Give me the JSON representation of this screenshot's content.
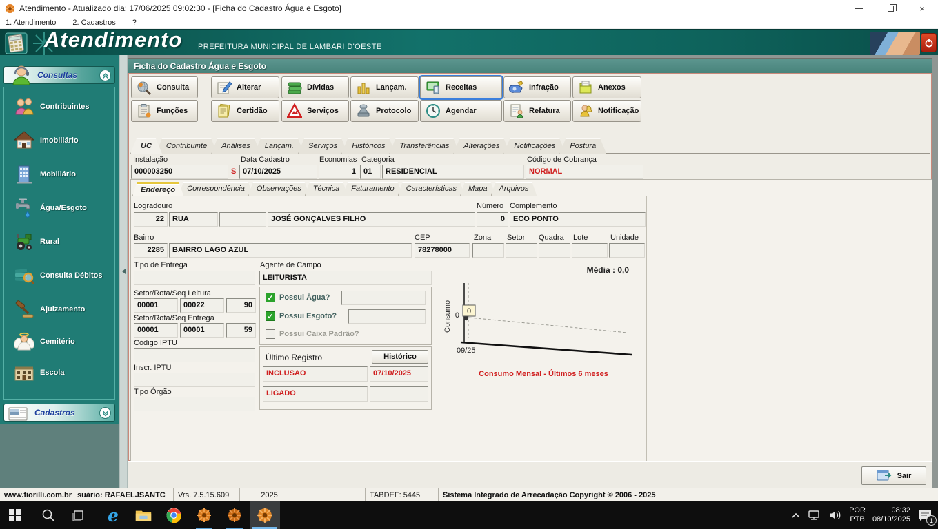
{
  "window": {
    "title": "Atendimento - Atualizado dia: 17/06/2025 09:02:30 - [Ficha do Cadastro Água e Esgoto]",
    "menu": [
      "1. Atendimento",
      "2. Cadastros",
      "?"
    ]
  },
  "banner": {
    "app_name": "Atendimento",
    "subtitle": "PREFEITURA MUNICIPAL DE LAMBARI D'OESTE"
  },
  "sidebar": {
    "consultas_label": "Consultas",
    "items": [
      {
        "label": "Contribuintes"
      },
      {
        "label": "Imobiliário"
      },
      {
        "label": "Mobiliário"
      },
      {
        "label": "Água/Esgoto"
      },
      {
        "label": "Rural"
      },
      {
        "label": "Consulta Débitos"
      },
      {
        "label": "Ajuizamento"
      },
      {
        "label": "Cemitério"
      },
      {
        "label": "Escola"
      }
    ],
    "cadastros_label": "Cadastros"
  },
  "main": {
    "form_title": "Ficha do Cadastro Água e Esgoto",
    "toolbar_row1": [
      "Consulta",
      "Alterar",
      "Dívidas",
      "Lançam.",
      "Receitas",
      "Infração",
      "Anexos"
    ],
    "toolbar_row2": [
      "Funções",
      "Certidão",
      "Serviços",
      "Protocolo",
      "Agendar",
      "Refatura",
      "Notificação"
    ],
    "tabs": [
      "UC",
      "Contribuinte",
      "Análises",
      "Lançam.",
      "Serviços",
      "Históricos",
      "Transferências",
      "Alterações",
      "Notificações",
      "Postura"
    ],
    "fields": {
      "instalacao_label": "Instalação",
      "instalacao": "000003250",
      "instalacao_flag": "S",
      "data_cadastro_label": "Data Cadastro",
      "data_cadastro": "07/10/2025",
      "economias_label": "Economias",
      "economias": "1",
      "categoria_label": "Categoria",
      "categoria_cod": "01",
      "categoria": "RESIDENCIAL",
      "cobranca_label": "Código de Cobrança",
      "cobranca": "NORMAL"
    },
    "subtabs": [
      "Endereço",
      "Correspondência",
      "Observações",
      "Técnica",
      "Faturamento",
      "Características",
      "Mapa",
      "Arquivos"
    ],
    "endereco": {
      "logradouro_label": "Logradouro",
      "logradouro_cod": "22",
      "logradouro_tipo": "RUA",
      "logradouro_pref": "",
      "logradouro_nome": "JOSÉ GONÇALVES FILHO",
      "numero_label": "Número",
      "numero": "0",
      "complemento_label": "Complemento",
      "complemento": "ECO PONTO",
      "bairro_label": "Bairro",
      "bairro_cod": "2285",
      "bairro_nome": "BAIRRO LAGO AZUL",
      "cep_label": "CEP",
      "cep": "78278000",
      "zona_label": "Zona",
      "zona": "",
      "setor_label": "Setor",
      "setor": "",
      "quadra_label": "Quadra",
      "quadra": "",
      "lote_label": "Lote",
      "lote": "",
      "unidade_label": "Unidade",
      "unidade": "",
      "tipo_entrega_label": "Tipo de Entrega",
      "tipo_entrega": "",
      "agente_label": "Agente de Campo",
      "agente": "LEITURISTA",
      "leitura_label": "Setor/Rota/Seq Leitura",
      "leitura_setor": "00001",
      "leitura_rota": "00022",
      "leitura_seq": "90",
      "entrega_label": "Setor/Rota/Seq Entrega",
      "entrega_setor": "00001",
      "entrega_rota": "00001",
      "entrega_seq": "59",
      "codigo_iptu_label": "Código IPTU",
      "codigo_iptu": "",
      "inscr_iptu_label": "Inscr. IPTU",
      "inscr_iptu": "",
      "tipo_orgao_label": "Tipo Órgão",
      "tipo_orgao": "",
      "possui_agua_label": "Possui Água?",
      "possui_agua_val": "",
      "possui_esgoto_label": "Possui Esgoto?",
      "possui_esgoto_val": "",
      "possui_caixa_label": "Possui Caixa Padrão?",
      "ultimo_registro_label": "Último Registro",
      "historico_label": "Histórico",
      "registro_tipo": "INCLUSAO",
      "registro_data": "07/10/2025",
      "registro_status": "LIGADO",
      "registro_extra": ""
    },
    "sair_label": "Sair"
  },
  "chart_data": {
    "type": "line",
    "title": "Consumo Mensal - Últimos 6 meses",
    "media_label": "Média : 0,0",
    "ylabel": "Consumo",
    "x": [
      "09/25"
    ],
    "values": [
      0
    ],
    "point_label": "0",
    "ytick": "0",
    "xtick": "09/25",
    "ylim": [
      0,
      1
    ],
    "grid": false,
    "legend": "none"
  },
  "statusbar": {
    "site": "www.fiorilli.com.br",
    "user": "suário: RAFAELJSANTC",
    "version": "Vrs. 7.5.15.609",
    "year": "2025",
    "tabdef": "TABDEF: 5445",
    "copyright": "Sistema Integrado de Arrecadação Copyright © 2006 - 2025"
  },
  "taskbar": {
    "lang_top": "POR",
    "lang_bottom": "PTB",
    "time": "08:32",
    "date": "08/10/2025",
    "badge": "1"
  }
}
